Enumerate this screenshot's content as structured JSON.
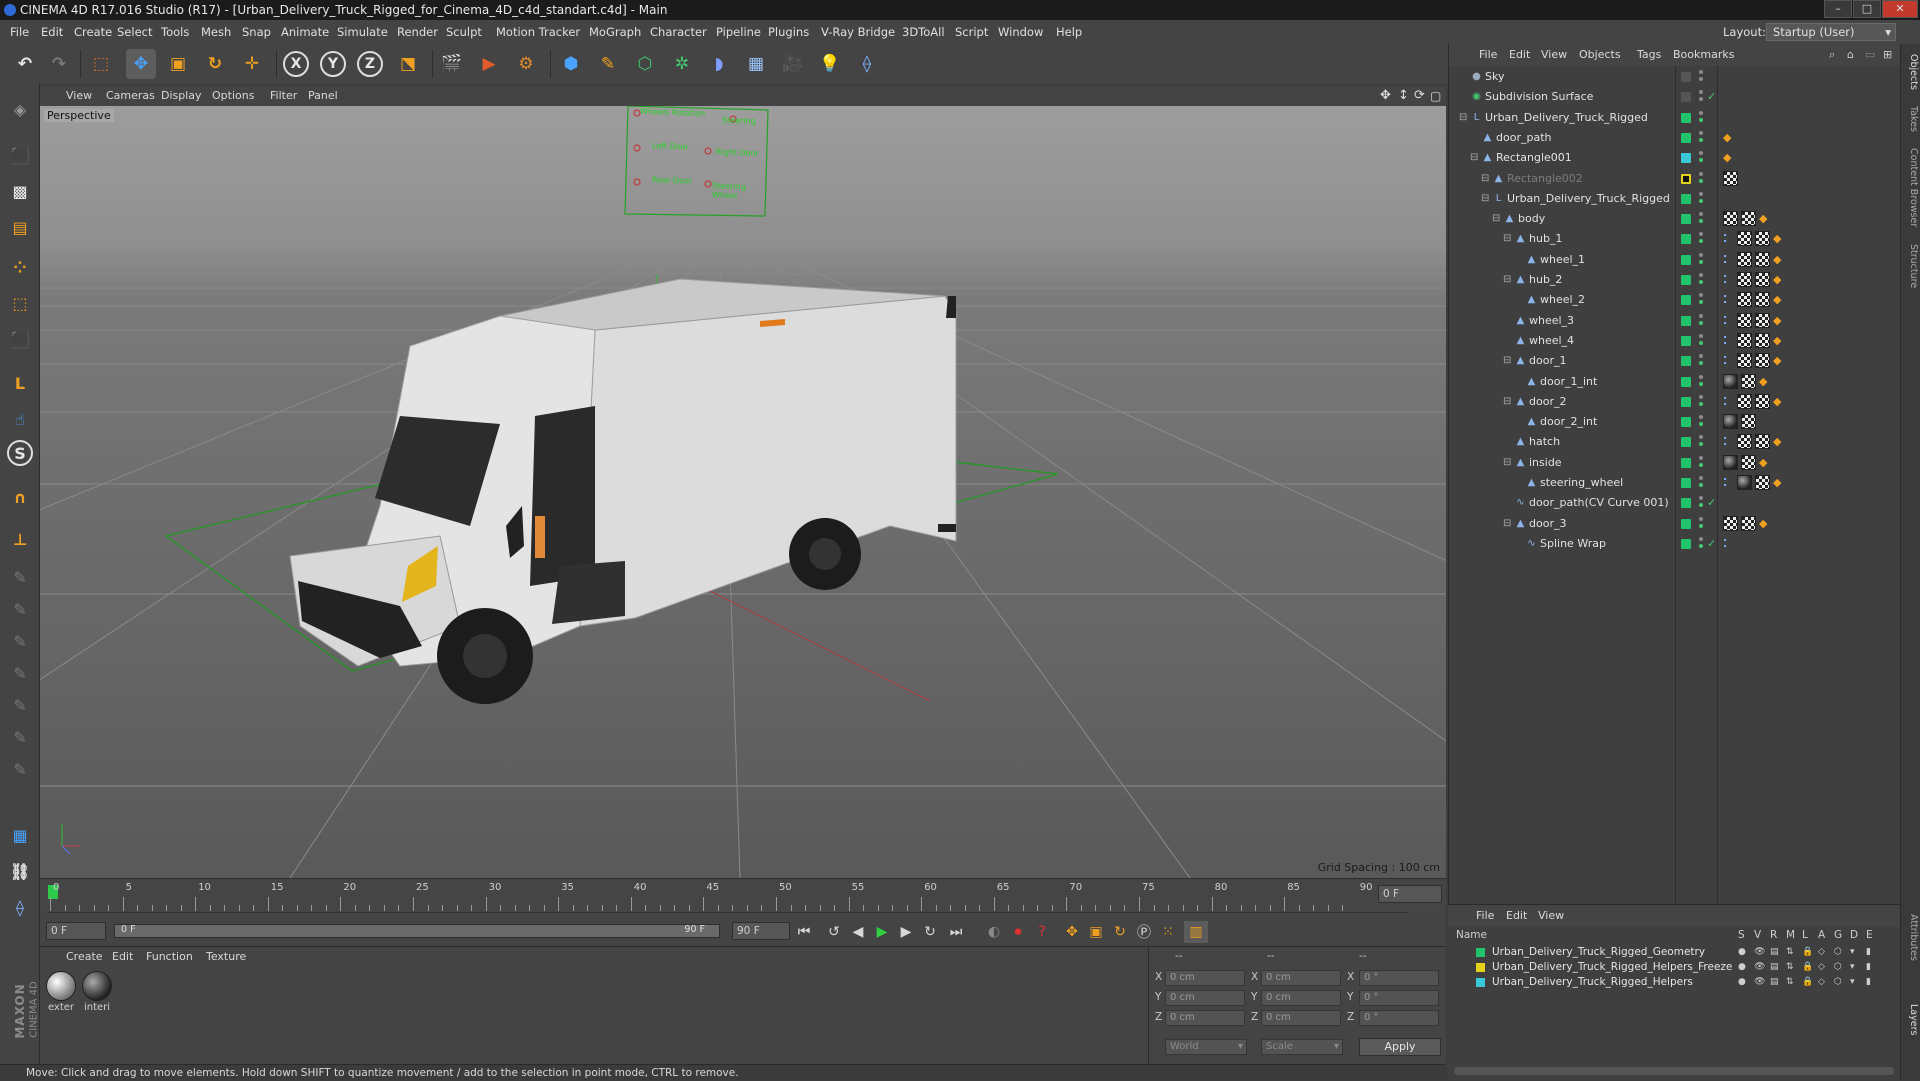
{
  "window": {
    "title": "CINEMA 4D R17.016 Studio (R17) - [Urban_Delivery_Truck_Rigged_for_Cinema_4D_c4d_standart.c4d] - Main",
    "controls": [
      "–",
      "□",
      "✕"
    ]
  },
  "menubar": {
    "items": [
      "File",
      "Edit",
      "Create",
      "Select",
      "Tools",
      "Mesh",
      "Snap",
      "Animate",
      "Simulate",
      "Render",
      "Sculpt",
      "Motion Tracker",
      "MoGraph",
      "Character",
      "Pipeline",
      "Plugins",
      "V-Ray Bridge",
      "3DToAll",
      "Script",
      "Window",
      "Help"
    ],
    "layout_label": "Layout:",
    "layout_value": "Startup (User)"
  },
  "toolbar": {
    "axis_x": "X",
    "axis_y": "Y",
    "axis_z": "Z"
  },
  "viewport": {
    "menu": [
      "View",
      "Cameras",
      "Display",
      "Options",
      "Filter",
      "Panel"
    ],
    "label": "Perspective",
    "grid_spacing": "Grid Spacing : 100 cm",
    "control_board": [
      "Wheels Rotation",
      "Steering",
      "Left Door",
      "Right Door",
      "Rear Door",
      "Steering Wheel"
    ]
  },
  "timeline": {
    "ticks": [
      "0",
      "5",
      "10",
      "15",
      "20",
      "25",
      "30",
      "35",
      "40",
      "45",
      "50",
      "55",
      "60",
      "65",
      "70",
      "75",
      "80",
      "85",
      "90"
    ],
    "current_frame_field": "0 F",
    "start_field": "0 F",
    "range_start": "0 F",
    "range_end": "90 F",
    "end_field": "90 F"
  },
  "materials": {
    "menu": [
      "Create",
      "Edit",
      "Function",
      "Texture"
    ],
    "items": [
      {
        "label": "exter"
      },
      {
        "label": "interi"
      }
    ]
  },
  "coords": {
    "headers": [
      "--",
      "--",
      "--"
    ],
    "rows": [
      {
        "axis": "X",
        "pos": "0 cm",
        "axis2": "X",
        "size": "0 cm",
        "axis3": "X",
        "rot": "0 °"
      },
      {
        "axis": "Y",
        "pos": "0 cm",
        "axis2": "Y",
        "size": "0 cm",
        "axis3": "Y",
        "rot": "0 °"
      },
      {
        "axis": "Z",
        "pos": "0 cm",
        "axis2": "Z",
        "size": "0 cm",
        "axis3": "Z",
        "rot": "0 °"
      }
    ],
    "mode_world": "World",
    "mode_scale": "Scale",
    "apply": "Apply"
  },
  "status": {
    "text": "Move: Click and drag to move elements. Hold down SHIFT to quantize movement / add to the selection in point mode, CTRL to remove."
  },
  "objects": {
    "menu": [
      "File",
      "Edit",
      "View",
      "Objects",
      "Tags",
      "Bookmarks"
    ],
    "rows": [
      {
        "name": "Sky",
        "layer": "",
        "dim": false
      },
      {
        "name": "Subdivision Surface",
        "layer": "",
        "dim": false
      },
      {
        "name": "Urban_Delivery_Truck_Rigged",
        "layer": "#21c46b",
        "dim": false
      },
      {
        "name": "door_path",
        "layer": "#21c46b",
        "dim": false
      },
      {
        "name": "Rectangle001",
        "layer": "#3ac7d8",
        "dim": false
      },
      {
        "name": "Rectangle002",
        "layer": "#e6d21a",
        "dim": true
      },
      {
        "name": "Urban_Delivery_Truck_Rigged",
        "layer": "#21c46b",
        "dim": false
      },
      {
        "name": "body",
        "layer": "#21c46b",
        "dim": false
      },
      {
        "name": "hub_1",
        "layer": "#21c46b",
        "dim": false
      },
      {
        "name": "wheel_1",
        "layer": "#21c46b",
        "dim": false
      },
      {
        "name": "hub_2",
        "layer": "#21c46b",
        "dim": false
      },
      {
        "name": "wheel_2",
        "layer": "#21c46b",
        "dim": false
      },
      {
        "name": "wheel_3",
        "layer": "#21c46b",
        "dim": false
      },
      {
        "name": "wheel_4",
        "layer": "#21c46b",
        "dim": false
      },
      {
        "name": "door_1",
        "layer": "#21c46b",
        "dim": false
      },
      {
        "name": "door_1_int",
        "layer": "#21c46b",
        "dim": false
      },
      {
        "name": "door_2",
        "layer": "#21c46b",
        "dim": false
      },
      {
        "name": "door_2_int",
        "layer": "#21c46b",
        "dim": false
      },
      {
        "name": "hatch",
        "layer": "#21c46b",
        "dim": false
      },
      {
        "name": "inside",
        "layer": "#21c46b",
        "dim": false
      },
      {
        "name": "steering_wheel",
        "layer": "#21c46b",
        "dim": false
      },
      {
        "name": "door_path(CV Curve 001)",
        "layer": "#21c46b",
        "dim": false
      },
      {
        "name": "door_3",
        "layer": "#21c46b",
        "dim": false
      },
      {
        "name": "Spline Wrap",
        "layer": "#21c46b",
        "dim": false
      }
    ]
  },
  "layers": {
    "menu": [
      "File",
      "Edit",
      "View"
    ],
    "columns": [
      "Name",
      "S",
      "V",
      "R",
      "M",
      "L",
      "A",
      "G",
      "D",
      "E"
    ],
    "rows": [
      {
        "name": "Urban_Delivery_Truck_Rigged_Geometry",
        "color": "#21c46b"
      },
      {
        "name": "Urban_Delivery_Truck_Rigged_Helpers_Freeze",
        "color": "#e6d21a"
      },
      {
        "name": "Urban_Delivery_Truck_Rigged_Helpers",
        "color": "#3ac7d8"
      }
    ]
  },
  "right_tabs": [
    "Objects",
    "Takes",
    "Content Browser",
    "Structure",
    "Attributes",
    "Layers"
  ],
  "brand": {
    "maxon": "MAXON",
    "cinema": "CINEMA 4D"
  }
}
